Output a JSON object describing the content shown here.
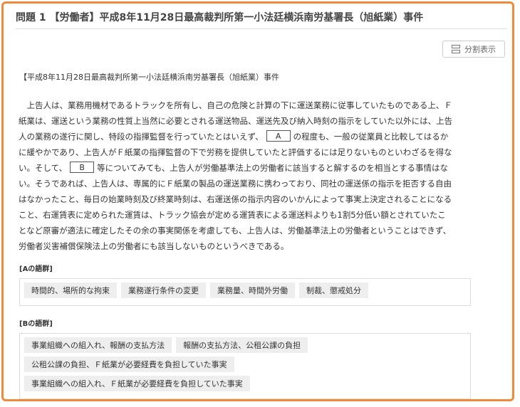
{
  "header": {
    "title": "問題 1 【労働者】平成8年11月28日最高裁判所第一小法廷横浜南労基署長（旭紙業）事件"
  },
  "toolbar": {
    "split_label": "分割表示"
  },
  "case_ref": "【平成8年11月28日最高裁判所第一小法廷横浜南労基署長（旭紙業）事件",
  "passage": {
    "l1": "上告人は、業務用機材であるトラックを所有し、自己の危険と計算の下に運送業務に従事していたものである上、Ｆ",
    "l2": "紙業は、運送という業務の性質上当然に必要とされる運送物品、運送先及び納入時刻の指示をしていた以外には、上告",
    "l3a": "人の業務の遂行に関し、特段の指揮監督を行っていたとはいえず、",
    "blank_a": "A",
    "l3b": "の程度も、一般の従業員と比較してはるか",
    "l4": "に緩やかであり、上告人がＦ紙業の指揮監督の下で労務を提供していたと評価するには足りないものといわざるを得な",
    "l5a": "い。そして、",
    "blank_b": "B",
    "l5b": "等についてみても、上告人が労働基準法上の労働者に該当すると解するのを相当とする事情はな",
    "l6": "い。そうであれば、上告人は、専属的にＦ紙業の製品の運送業務に携わっており、同社の運送係の指示を拒否する自由",
    "l7": "はなかったこと、毎日の始業時刻及び終業時刻は、右運送係の指示内容のいかんによって事実上決定されることになる",
    "l8": "こと、右運賃表に定められた運賃は、トラック協会が定める運賃表による運送料よりも1割5分低い額とされていたこ",
    "l9": "となど原審が適法に確定したその余の事実関係を考慮しても、上告人は、労働基準法上の労働者ということはできず、",
    "l10": "労働者災害補償保険法上の労働者にも該当しないものというべきである。"
  },
  "group_a": {
    "label": "[Aの語群]",
    "items": [
      "時間的、場所的な拘束",
      "業務遂行条件の変更",
      "業務量、時間外労働",
      "制裁、懲戒処分"
    ]
  },
  "group_b": {
    "label": "[Bの語群]",
    "items": [
      "事業組織への組入れ、報酬の支払方法",
      "報酬の支払方法、公租公課の負担",
      "公租公課の負担、Ｆ紙業が必要経費を負担していた事実",
      "事業組織への組入れ、Ｆ紙業が必要経費を負担していた事実"
    ]
  },
  "colors": {
    "frame_border": "#ee8a3a",
    "chip_bg": "#eeeeee"
  }
}
